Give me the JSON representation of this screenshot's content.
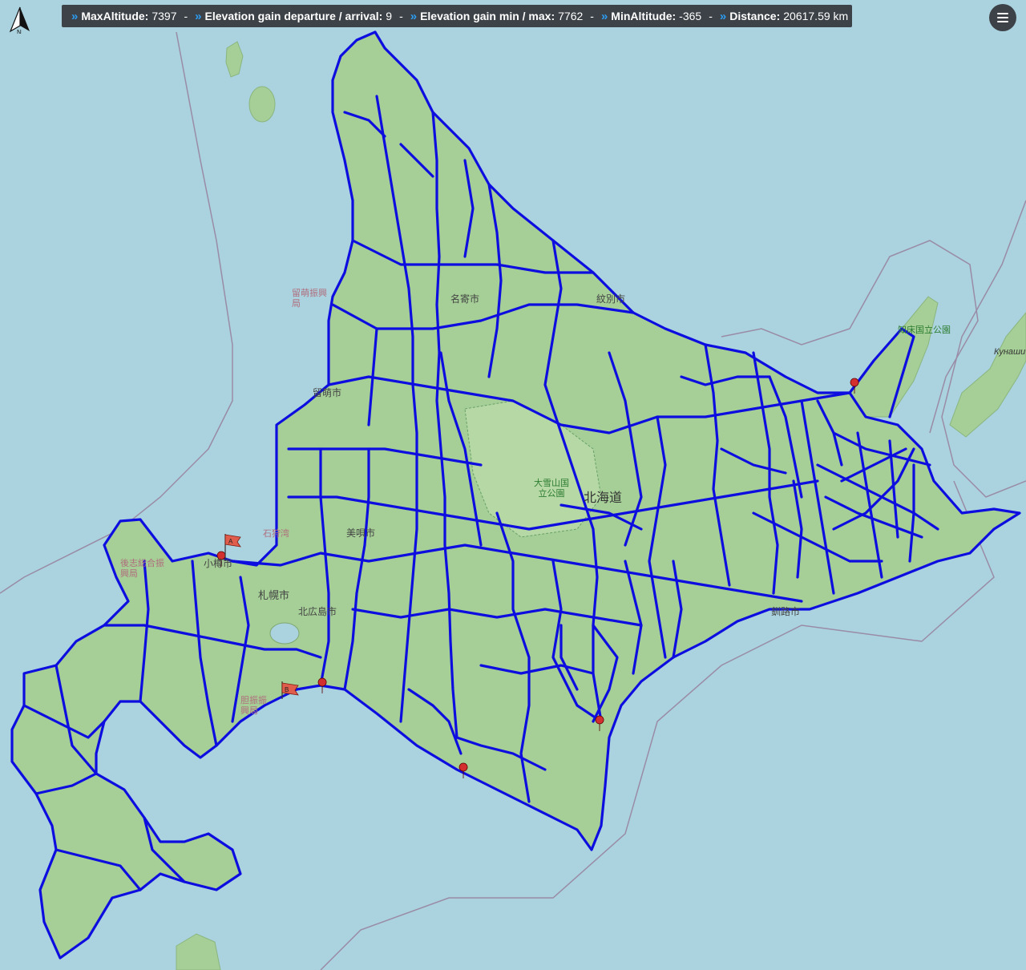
{
  "stats": [
    {
      "label": "MaxAltitude:",
      "value": "7397"
    },
    {
      "label": "Elevation gain departure / arrival:",
      "value": "9"
    },
    {
      "label": "Elevation gain min / max:",
      "value": "7762"
    },
    {
      "label": "MinAltitude:",
      "value": "-365"
    },
    {
      "label": "Distance:",
      "value": "20617.59 km"
    }
  ],
  "separator": "-",
  "compass_letter": "N",
  "markers": {
    "start": "A",
    "end": "B"
  },
  "labels": {
    "hokkaido": "北海道",
    "sapporo": "札幌市",
    "otaru": "小樽市",
    "rumoi": "留萌市",
    "nayoro": "名寄市",
    "monbetsu": "紋別市",
    "bibai": "美唄市",
    "kitahiroshima": "北広島市",
    "kushiro": "釧路市",
    "daisetsuzan": "大雪山国立公園",
    "shiretoko": "知床国立公園",
    "rumoi_subpref": "留萌振興局",
    "ishikari_bay": "石狩湾",
    "iburi_subpref": "胆振振興局",
    "shiribeshi": "後志総合振興局",
    "kunashir": "Кунаши"
  },
  "colors": {
    "sea": "#aad3df",
    "land": "#a5cf96",
    "route": "#0d0de0",
    "bar": "#3d4248",
    "accent": "#2d9cf0",
    "pin": "#d32f2f"
  }
}
